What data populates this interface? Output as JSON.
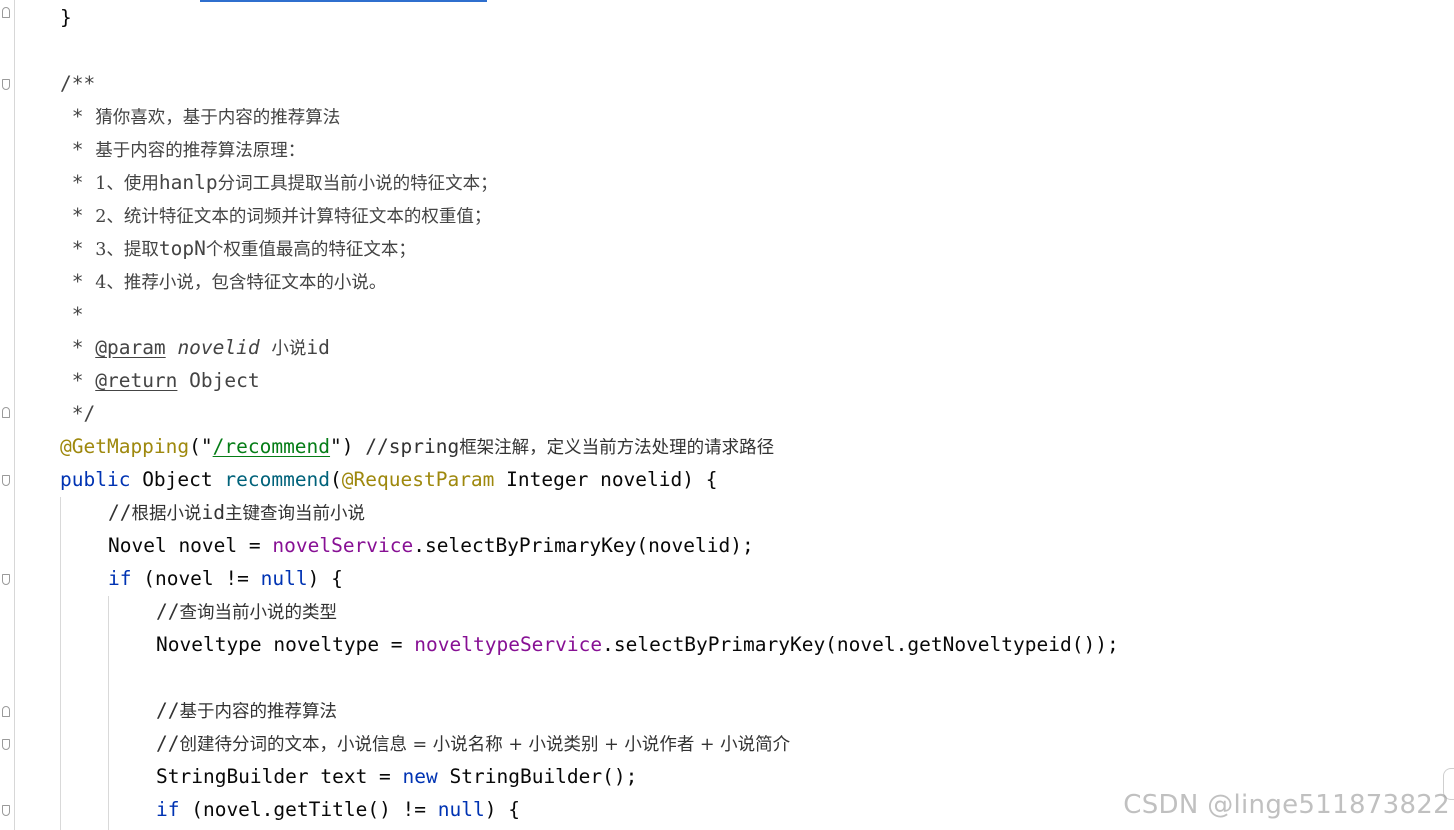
{
  "editor": {
    "lines": {
      "l01": {
        "brace": "}"
      },
      "l02": {
        "text": "/**"
      },
      "l03": {
        "star": " * ",
        "text": "猜你喜欢，基于内容的推荐算法"
      },
      "l04": {
        "star": " * ",
        "text": "基于内容的推荐算法原理："
      },
      "l05": {
        "star": " * ",
        "pre": "1、使用",
        "mono": "hanlp",
        "post": "分词工具提取当前小说的特征文本；"
      },
      "l06": {
        "star": " * ",
        "pre": "2、统计特征文本的词频并计算特征文本的权重值；"
      },
      "l07": {
        "star": " * ",
        "pre": "3、提取",
        "mono": "topN",
        "post": "个权重值最高的特征文本；"
      },
      "l08": {
        "star": " * ",
        "pre": "4、推荐小说，包含特征文本的小说。"
      },
      "l09": {
        "star": " *"
      },
      "l10": {
        "star": " * ",
        "tag": "@param",
        "sp1": " ",
        "param": "novelid",
        "sp2": " ",
        "desc": "小说",
        "mono": "id"
      },
      "l11": {
        "star": " * ",
        "tag": "@return",
        "rest": " Object"
      },
      "l12": {
        "text": " */"
      },
      "l13": {
        "anno": "@GetMapping",
        "p1": "(\"",
        "path": "/recommend",
        "p2": "\") ",
        "cmt": "//spring",
        "cjk": "框架注解，定义当前方法处理的请求路径"
      },
      "l14": {
        "kw": "public",
        "t1": " Object ",
        "method": "recommend",
        "t2": "(",
        "anno": "@RequestParam",
        "t3": " Integer novelid) {"
      },
      "l15": {
        "cmt": "//",
        "cjk1": "根据小说",
        "mono": "id",
        "cjk2": "主键查询当前小说"
      },
      "l16": {
        "t1": "Novel novel = ",
        "field": "novelService",
        "t2": ".selectByPrimaryKey(novelid);"
      },
      "l17": {
        "kw": "if",
        "t1": " (novel != ",
        "kw2": "null",
        "t2": ") {"
      },
      "l18": {
        "cmt": "//",
        "cjk": "查询当前小说的类型"
      },
      "l19": {
        "t1": "Noveltype noveltype = ",
        "field": "noveltypeService",
        "t2": ".selectByPrimaryKey(novel.getNoveltypeid());"
      },
      "l20": {
        "cmt": "//",
        "cjk": "基于内容的推荐算法"
      },
      "l21": {
        "cmt": "//",
        "cjk": "创建待分词的文本，小说信息 = 小说名称 + 小说类别 + 小说作者 + 小说简介"
      },
      "l22": {
        "t1": "StringBuilder text = ",
        "kw": "new",
        "t2": " StringBuilder();"
      },
      "l23": {
        "kw": "if",
        "t1": " (novel.getTitle() != ",
        "kw2": "null",
        "t2": ") {"
      }
    }
  },
  "watermark": {
    "text": "CSDN @linge511873822"
  },
  "colors": {
    "keyword": "#0033b3",
    "method": "#00627a",
    "field": "#871094",
    "annotation": "#9e880d",
    "string": "#067d17",
    "comment": "#8c8c8c",
    "text": "#080808"
  }
}
